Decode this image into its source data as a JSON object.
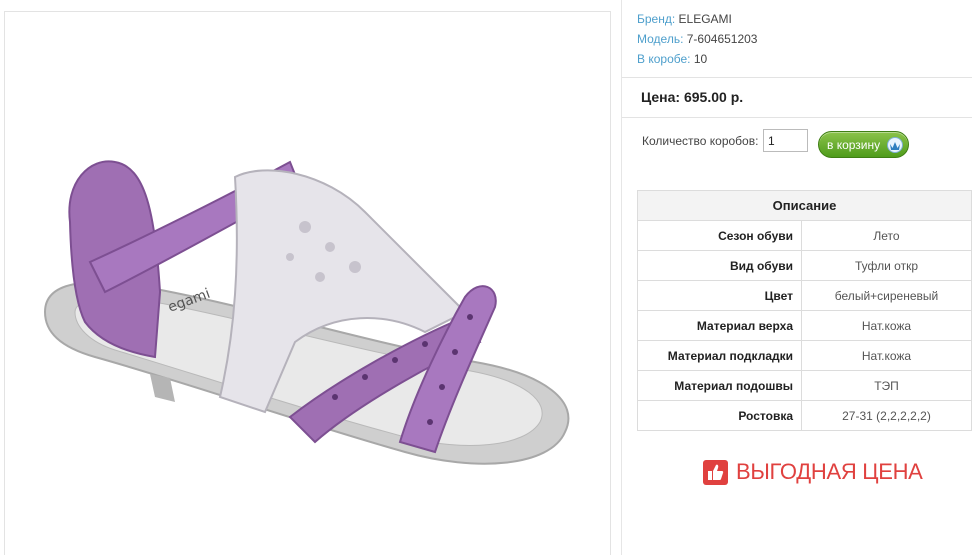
{
  "product": {
    "brand_label": "Бренд:",
    "brand_value": "ELEGAMI",
    "model_label": "Модель:",
    "model_value": "7-604651203",
    "box_label": "В коробе:",
    "box_value": "10"
  },
  "price": {
    "text": "Цена: 695.00 р."
  },
  "order": {
    "qty_label": "Количество коробов:",
    "qty_value": "1",
    "cart_label": "в корзину"
  },
  "description": {
    "title": "Описание",
    "rows": [
      {
        "label": "Сезон обуви",
        "value": "Лето"
      },
      {
        "label": "Вид обуви",
        "value": "Туфли откр"
      },
      {
        "label": "Цвет",
        "value": "белый+сиреневый"
      },
      {
        "label": "Материал верха",
        "value": "Нат.кожа"
      },
      {
        "label": "Материал подкладки",
        "value": "Нат.кожа"
      },
      {
        "label": "Материал подошвы",
        "value": "ТЭП"
      },
      {
        "label": "Ростовка",
        "value": "27-31 (2,2,2,2,2)"
      }
    ]
  },
  "promo": {
    "text": "ВЫГОДНАЯ ЦЕНА"
  },
  "image": {
    "sole_text": "egami"
  },
  "colors": {
    "accent_link": "#4e9fcc",
    "button_green": "#4f9c1c",
    "promo_red": "#e0413f",
    "sandal_lilac": "#9f6fb3"
  }
}
